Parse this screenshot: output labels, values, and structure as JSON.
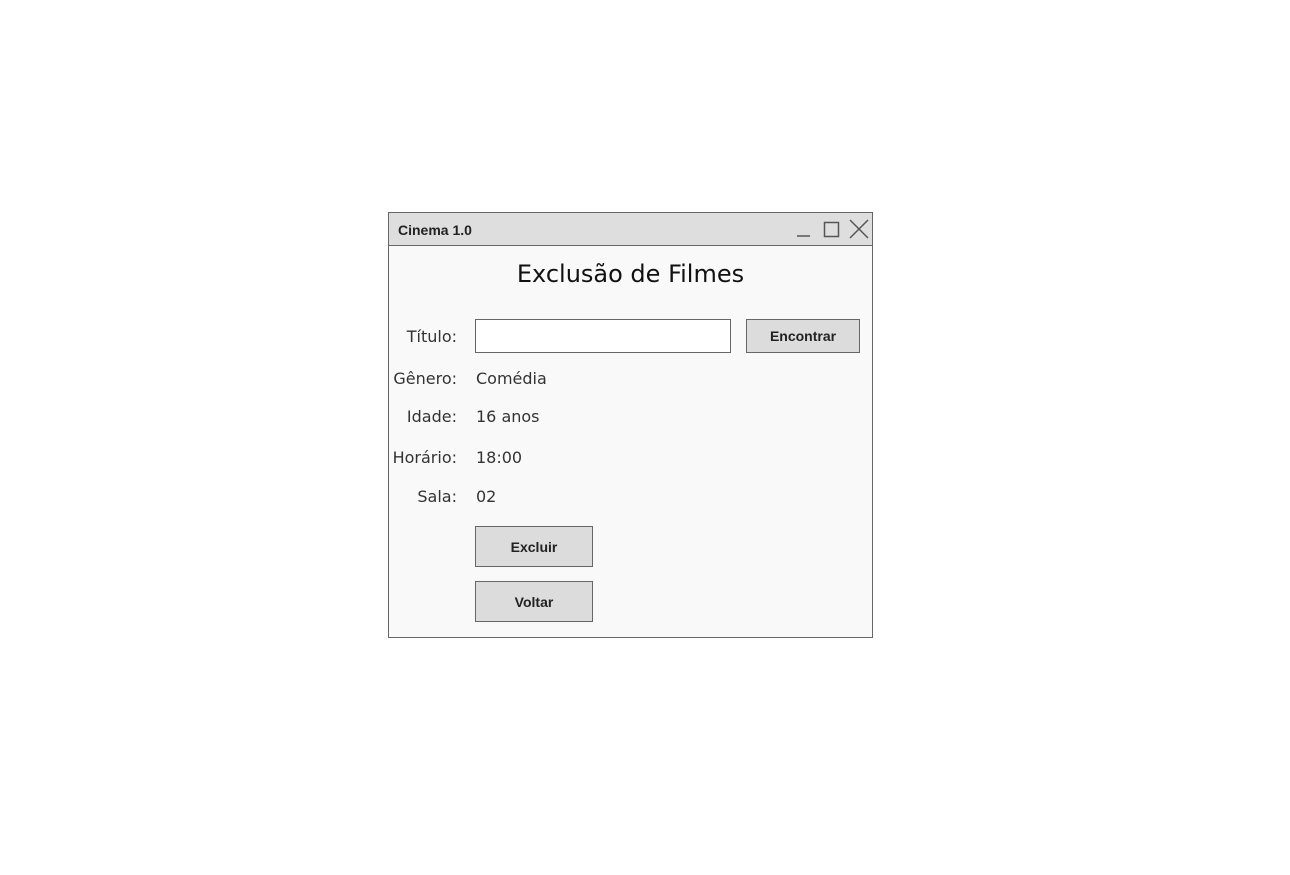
{
  "window": {
    "title": "Cinema 1.0",
    "controls": [
      "minimize-icon",
      "maximize-icon",
      "close-icon"
    ]
  },
  "heading": "Exclusão de Filmes",
  "form": {
    "title_label": "Título:",
    "title_value": "",
    "find_button": "Encontrar",
    "fields": [
      {
        "label": "Gênero:",
        "value": "Comédia"
      },
      {
        "label": "Idade:",
        "value": "16 anos"
      },
      {
        "label": "Horário:",
        "value": "18:00"
      },
      {
        "label": "Sala:",
        "value": "02"
      }
    ]
  },
  "buttons": {
    "delete": "Excluir",
    "back": "Voltar"
  },
  "colors": {
    "titlebar": "#dedede",
    "window_bg": "#f9f9f9",
    "button_bg": "#dcdcdc",
    "border": "#666666"
  }
}
